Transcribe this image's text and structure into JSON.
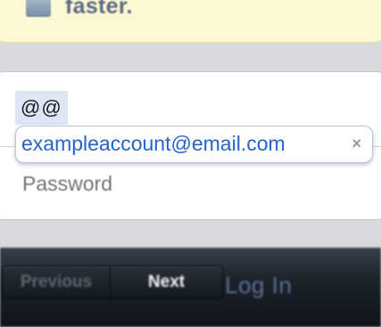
{
  "banner": {
    "text": "faster.",
    "icon": "app-icon"
  },
  "form": {
    "typed_text": "@@",
    "suggestion": {
      "text": "exampleaccount@email.com",
      "dismiss_glyph": "×"
    },
    "password_placeholder": "Password"
  },
  "toolbar": {
    "previous_label": "Previous",
    "next_label": "Next",
    "login_label": "Log In"
  },
  "colors": {
    "banner_bg": "#fcf8d3",
    "suggestion_text": "#2463c9",
    "toolbar_bg": "#1d232b"
  }
}
